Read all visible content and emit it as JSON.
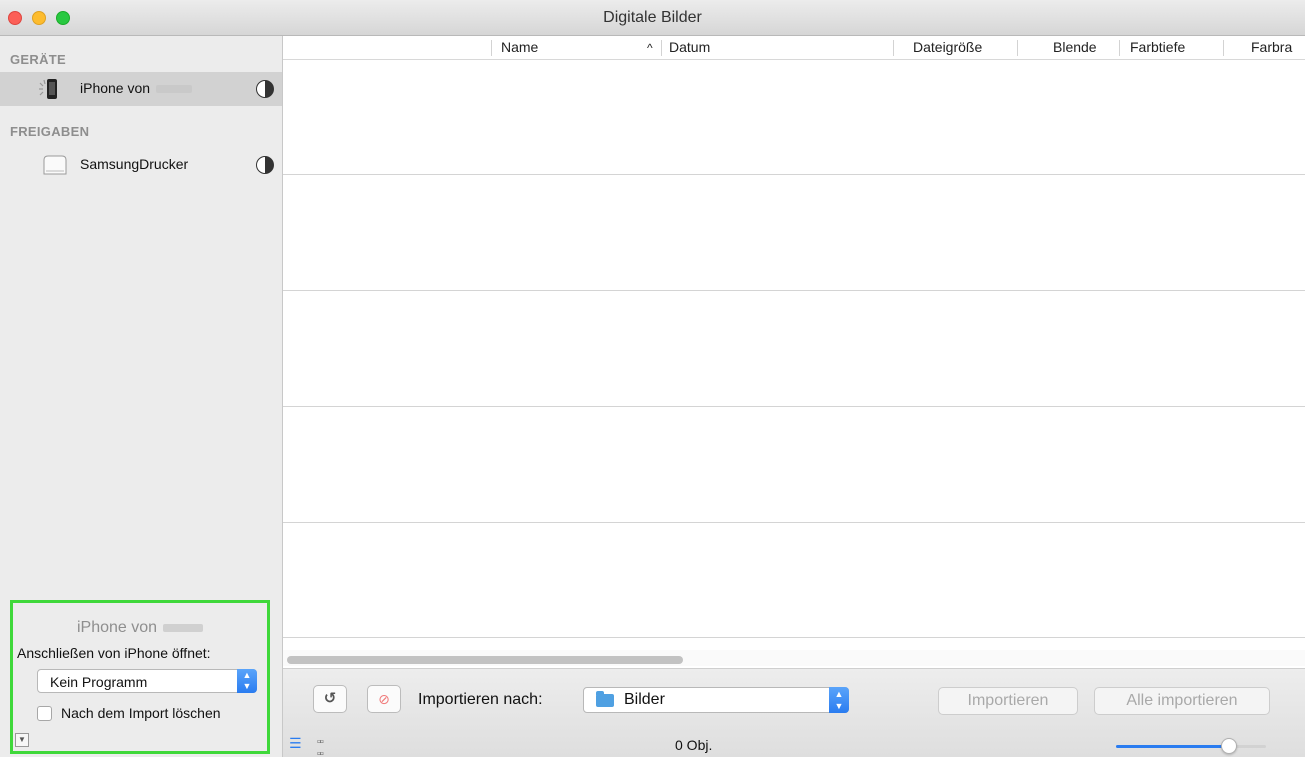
{
  "window": {
    "title": "Digitale Bilder"
  },
  "sidebar": {
    "devices_header": "GERÄTE",
    "devices": [
      {
        "label": "iPhone von",
        "icon": "iphone-icon",
        "selected": true
      }
    ],
    "shares_header": "FREIGABEN",
    "shares": [
      {
        "label": "SamsungDrucker",
        "icon": "drive-icon"
      }
    ],
    "options": {
      "device_name": "iPhone von",
      "connect_label": "Anschließen von iPhone öffnet:",
      "app_selected": "Kein Programm",
      "delete_after_import_label": "Nach dem Import löschen",
      "delete_after_import_checked": false
    }
  },
  "columns": [
    "Name",
    "Datum",
    "Dateigröße",
    "Blende",
    "Farbtiefe",
    "Farbra"
  ],
  "sort_indicator": "^",
  "toolbar": {
    "import_to_label": "Importieren nach:",
    "destination": "Bilder",
    "import_label": "Importieren",
    "import_all_label": "Alle importieren"
  },
  "status": {
    "count": "0 Obj.",
    "zoom_level": 0.78
  },
  "colors": {
    "selection_border": "#3fd83a",
    "accent": "#2a7cf0"
  }
}
